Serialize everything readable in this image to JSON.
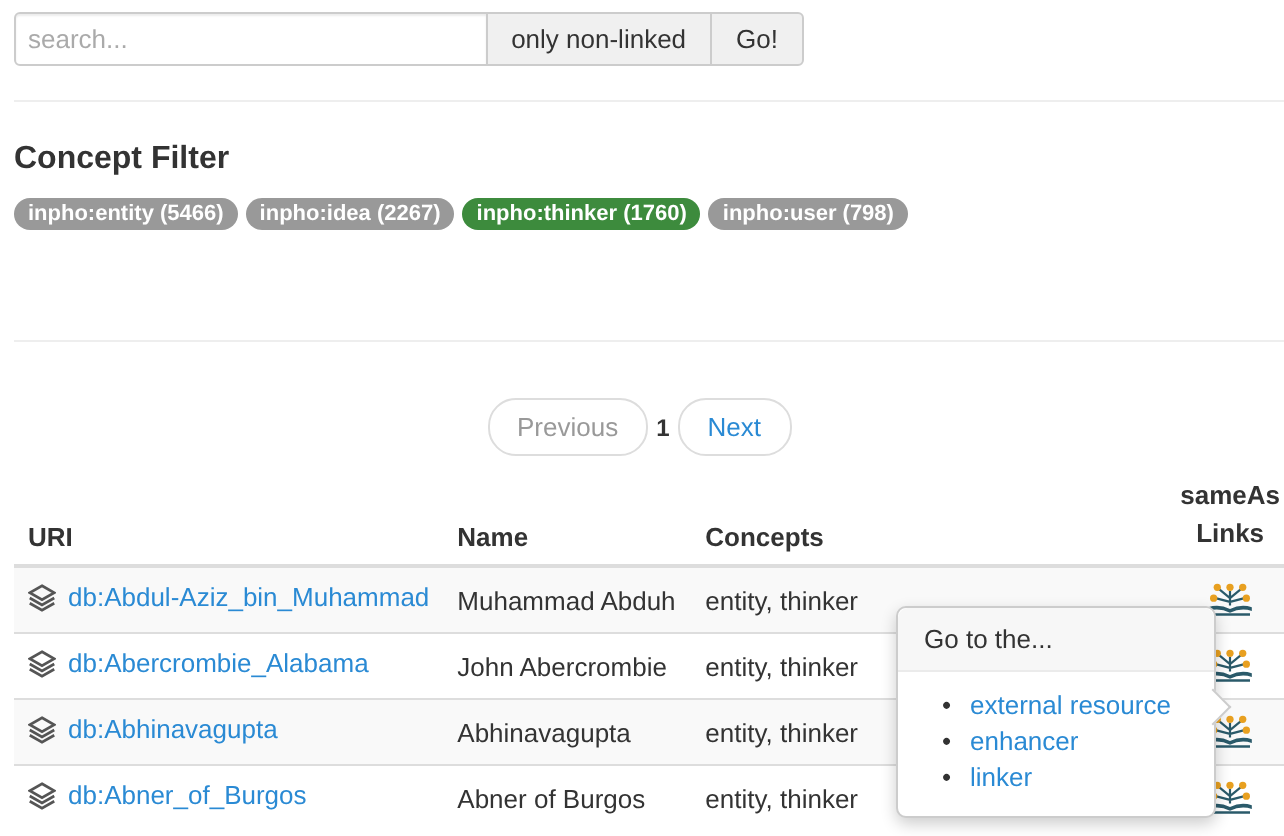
{
  "search": {
    "placeholder": "search...",
    "buttons": [
      "only non-linked",
      "Go!"
    ]
  },
  "concept_filter": {
    "title": "Concept Filter",
    "tags": [
      {
        "label": "inpho:entity (5466)",
        "selected": false
      },
      {
        "label": "inpho:idea (2267)",
        "selected": false
      },
      {
        "label": "inpho:thinker (1760)",
        "selected": true
      },
      {
        "label": "inpho:user (798)",
        "selected": false
      }
    ]
  },
  "pagination": {
    "previous": "Previous",
    "page": "1",
    "next": "Next"
  },
  "table": {
    "columns": [
      "URI",
      "Name",
      "Concepts",
      "sameAs Links"
    ],
    "rows": [
      {
        "uri": "db:Abdul-Aziz_bin_Muhammad",
        "name": "Muhammad Abduh",
        "concepts": "entity, thinker"
      },
      {
        "uri": "db:Abercrombie_Alabama",
        "name": "John Abercrombie",
        "concepts": "entity, thinker"
      },
      {
        "uri": "db:Abhinavagupta",
        "name": "Abhinavagupta",
        "concepts": "entity, thinker"
      },
      {
        "uri": "db:Abner_of_Burgos",
        "name": "Abner of Burgos",
        "concepts": "entity, thinker"
      }
    ]
  },
  "popover": {
    "title": "Go to the...",
    "links": [
      {
        "bullet": "•",
        "label": "external resource"
      },
      {
        "bullet": "•",
        "label": "enhancer"
      },
      {
        "bullet": "•",
        "label": "linker"
      }
    ]
  }
}
